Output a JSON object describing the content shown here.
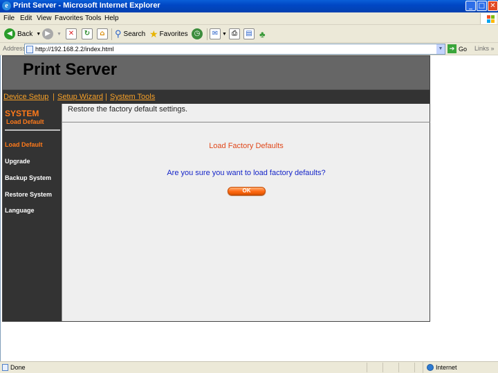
{
  "window": {
    "title": "Print Server - Microsoft Internet Explorer",
    "minimize": "_",
    "maximize": "□",
    "close": "✕"
  },
  "menu": [
    "File",
    "Edit",
    "View",
    "Favorites",
    "Tools",
    "Help"
  ],
  "toolbar": {
    "back": "Back",
    "search": "Search",
    "favorites": "Favorites"
  },
  "address": {
    "label": "Address",
    "url": "http://192.168.2.2/index.html",
    "go": "Go",
    "links": "Links"
  },
  "page": {
    "title": "Print Server",
    "nav": [
      "Device Setup",
      "Setup Wizard",
      "System Tools"
    ],
    "sidebar": {
      "section": "SYSTEM",
      "subsection": "Load Default",
      "items": [
        "Load Default",
        "Upgrade",
        "Backup System",
        "Restore System",
        "Language"
      ],
      "active_index": 0
    },
    "description": "Restore the factory default settings.",
    "form_title": "Load Factory Defaults",
    "question": "Are you sure you want to load factory defaults?",
    "ok_label": "OK"
  },
  "status": {
    "text": "Done",
    "zone": "Internet"
  },
  "colors": {
    "titlebar": "#0047c4",
    "accent_orange": "#ff7a1a",
    "nav_link": "#f6a028",
    "question_blue": "#1525c8",
    "form_title": "#e0471a"
  }
}
